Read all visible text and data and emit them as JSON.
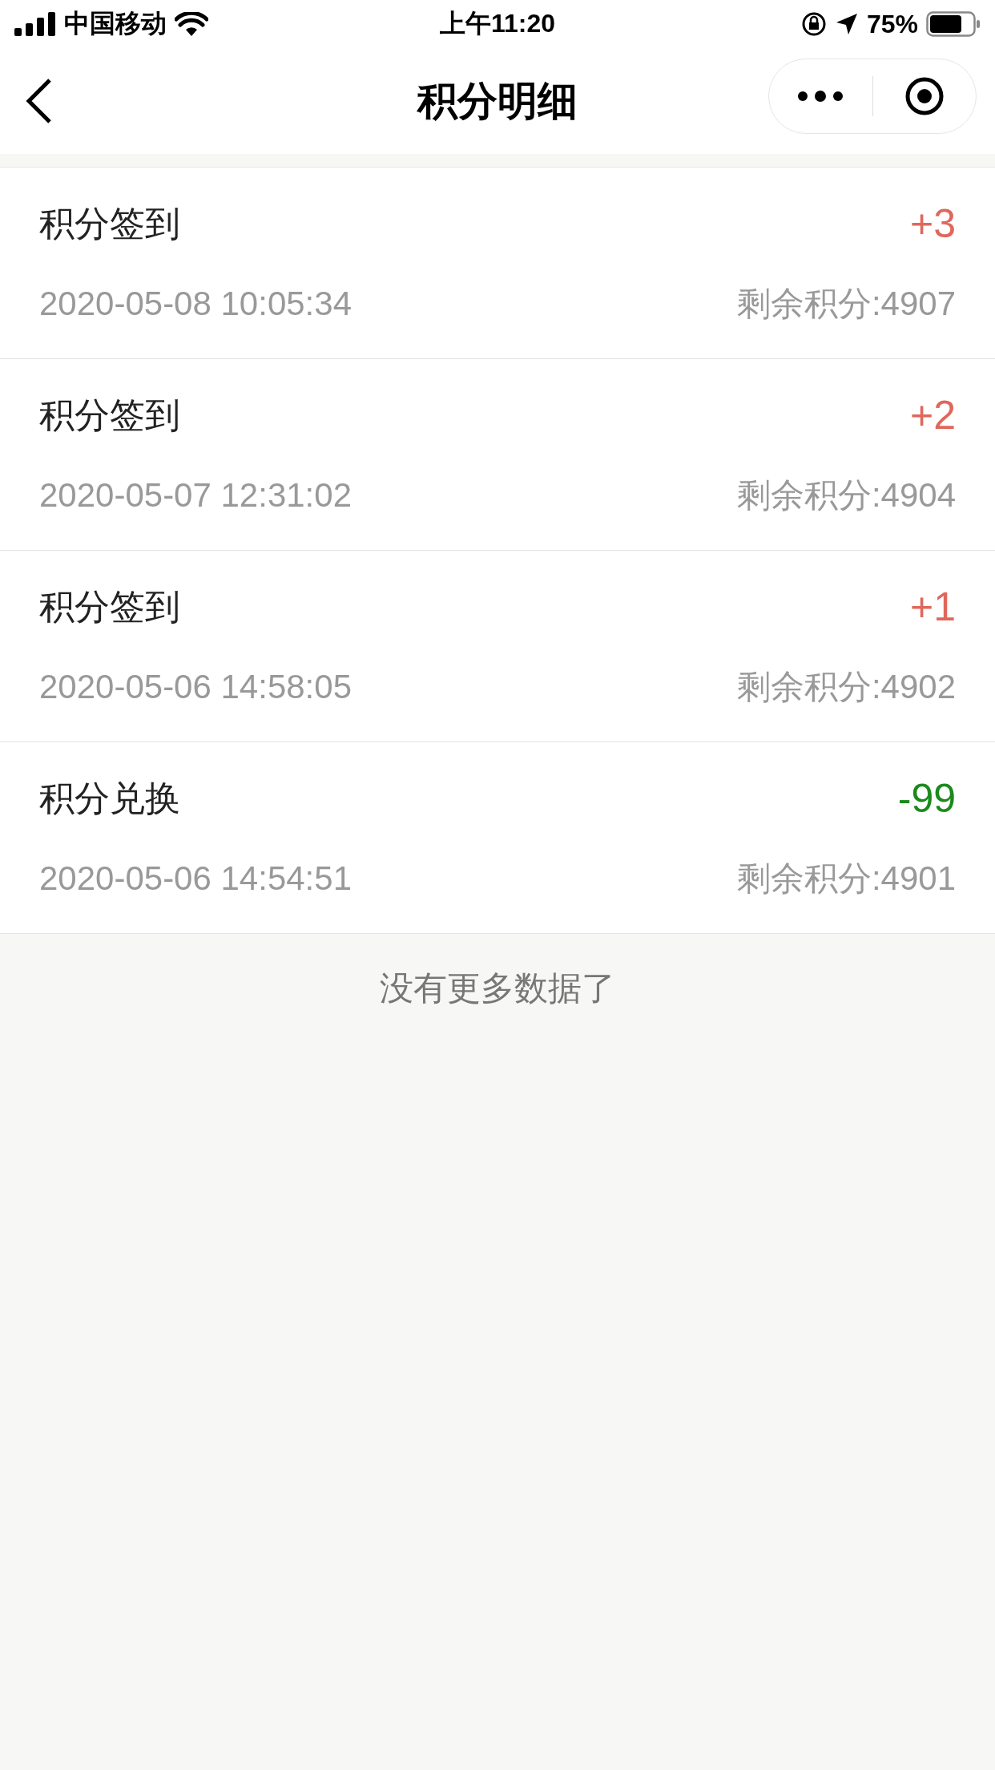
{
  "status_bar": {
    "carrier": "中国移动",
    "time": "上午11:20",
    "battery": "75%"
  },
  "nav": {
    "title": "积分明细"
  },
  "records": [
    {
      "title": "积分签到",
      "amount": "+3",
      "kind": "income",
      "date": "2020-05-08 10:05:34",
      "balance": "剩余积分:4907"
    },
    {
      "title": "积分签到",
      "amount": "+2",
      "kind": "income",
      "date": "2020-05-07 12:31:02",
      "balance": "剩余积分:4904"
    },
    {
      "title": "积分签到",
      "amount": "+1",
      "kind": "income",
      "date": "2020-05-06 14:58:05",
      "balance": "剩余积分:4902"
    },
    {
      "title": "积分兑换",
      "amount": "-99",
      "kind": "expense",
      "date": "2020-05-06 14:54:51",
      "balance": "剩余积分:4901"
    }
  ],
  "footer": "没有更多数据了"
}
